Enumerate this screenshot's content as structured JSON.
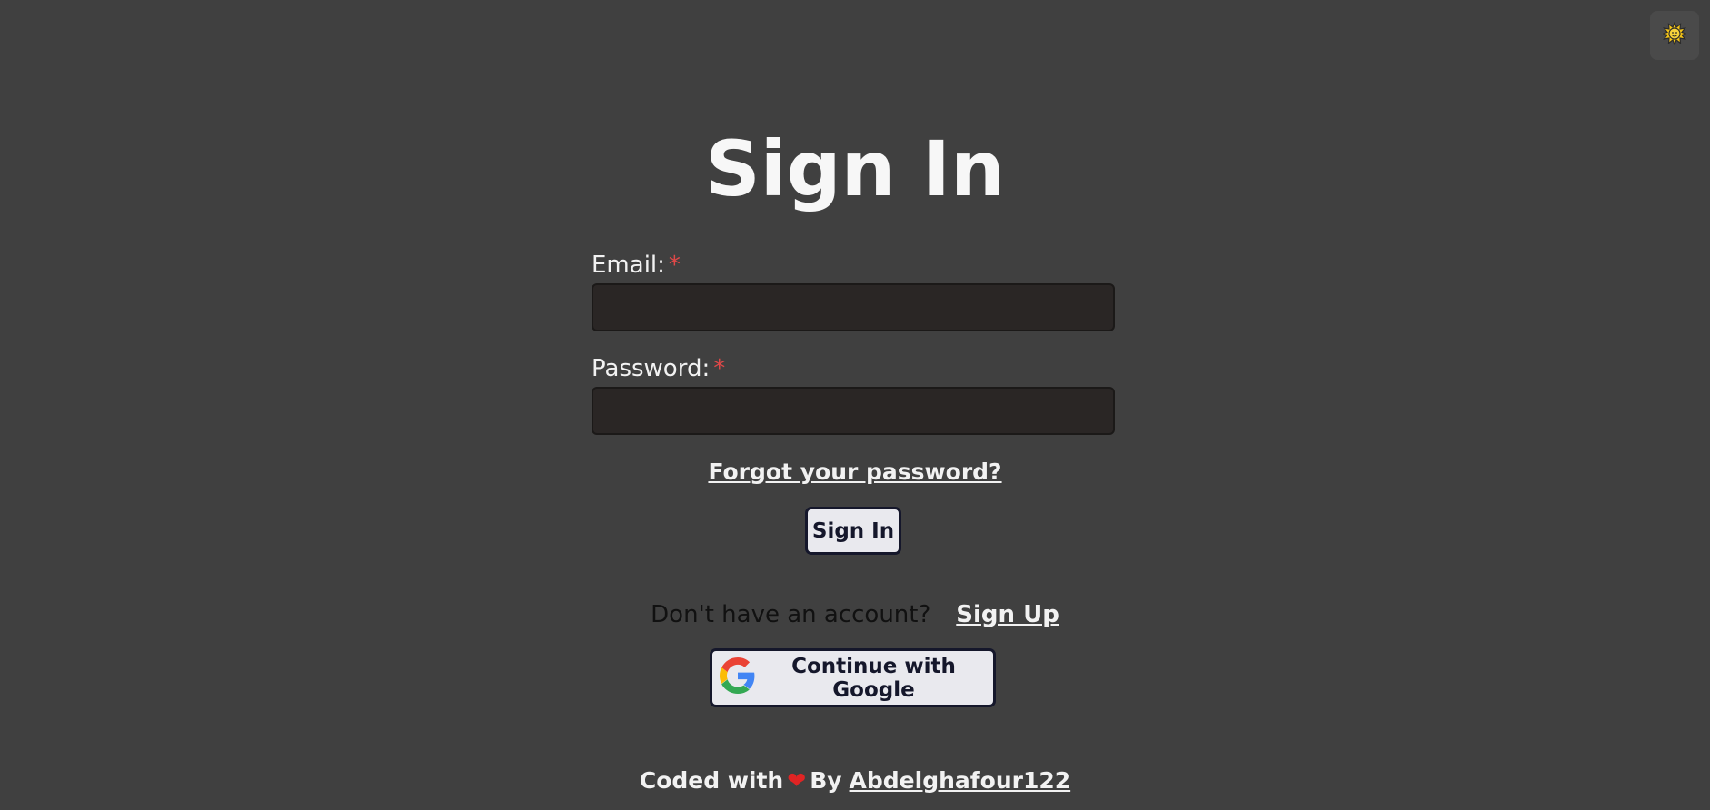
{
  "theme_toggle": {
    "icon": "sun-icon"
  },
  "page_title": "Sign In",
  "form": {
    "email_label": "Email:",
    "password_label": "Password:",
    "required_mark": "*",
    "email_value": "",
    "password_value": "",
    "forgot_password_link": "Forgot your password?",
    "submit_label": "Sign In"
  },
  "signup": {
    "prompt": "Don't have an account?",
    "link": "Sign Up"
  },
  "google_button": {
    "label": "Continue with Google",
    "icon": "google-logo-icon"
  },
  "footer": {
    "coded_with": "Coded with",
    "heart": "❤",
    "by": "By",
    "author": "Abdelghafour122"
  },
  "colors": {
    "background": "#404040",
    "input_background": "#2a2625",
    "button_background": "#e9e9ee",
    "button_border": "#15172b",
    "required": "#e04848",
    "heart": "#e02424"
  }
}
